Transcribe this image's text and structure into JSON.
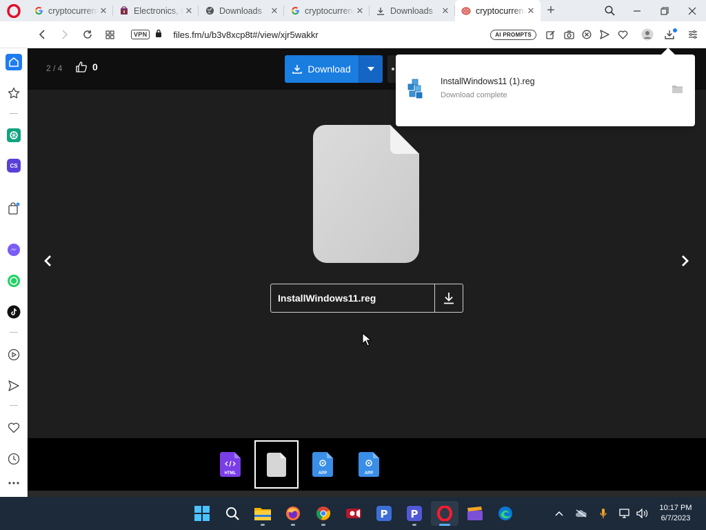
{
  "browser": {
    "tabs": [
      {
        "title": "cryptocurrenc",
        "favicon": "google-icon",
        "active": false
      },
      {
        "title": "Electronics, C",
        "favicon": "shop-icon",
        "active": false
      },
      {
        "title": "Downloads",
        "favicon": "globe-icon",
        "active": false
      },
      {
        "title": "cryptocurrenc",
        "favicon": "google-icon",
        "active": false
      },
      {
        "title": "Downloads",
        "favicon": "download-icon",
        "active": false
      },
      {
        "title": "cryptocurrenc",
        "favicon": "brain-icon",
        "active": true
      }
    ],
    "new_tab": "+",
    "address": {
      "vpn_label": "VPN",
      "url": "files.fm/u/b3v8xcp8t#/view/xjr5wakkr"
    },
    "ai_prompts_label": "AI PROMPTS",
    "accent_color": "#1e7cf2"
  },
  "sidebar": {
    "items": [
      "home-icon",
      "star-icon",
      "chatgpt-icon",
      "cs-icon",
      "shopping-bag-icon",
      "messenger-icon",
      "whatsapp-icon",
      "tiktok-icon",
      "player-icon",
      "send-icon",
      "heart-icon",
      "history-icon",
      "more-icon"
    ],
    "cs_label": "CS"
  },
  "viewer": {
    "counter": "2 / 4",
    "likes": "0",
    "download_label": "Download",
    "download_color": "#1a7de0",
    "filename": "InstallWindows11.reg",
    "thumbnails": [
      {
        "type": "html",
        "label": "HTML",
        "selected": false
      },
      {
        "type": "file",
        "label": "",
        "selected": true
      },
      {
        "type": "app",
        "label": "APP",
        "selected": false
      },
      {
        "type": "app",
        "label": "APP",
        "selected": false
      }
    ]
  },
  "downloads_popup": {
    "file_name": "InstallWindows11 (1).reg",
    "status": "Download complete"
  },
  "taskbar": {
    "apps": [
      "windows-start-icon",
      "search-icon",
      "file-explorer-icon",
      "firefox-icon",
      "chrome-icon",
      "video-editor-icon",
      "p-app-icon",
      "p-app-2-icon",
      "opera-icon",
      "clapperboard-icon",
      "edge-icon"
    ],
    "time": "10:17 PM",
    "date": "6/7/2023"
  }
}
